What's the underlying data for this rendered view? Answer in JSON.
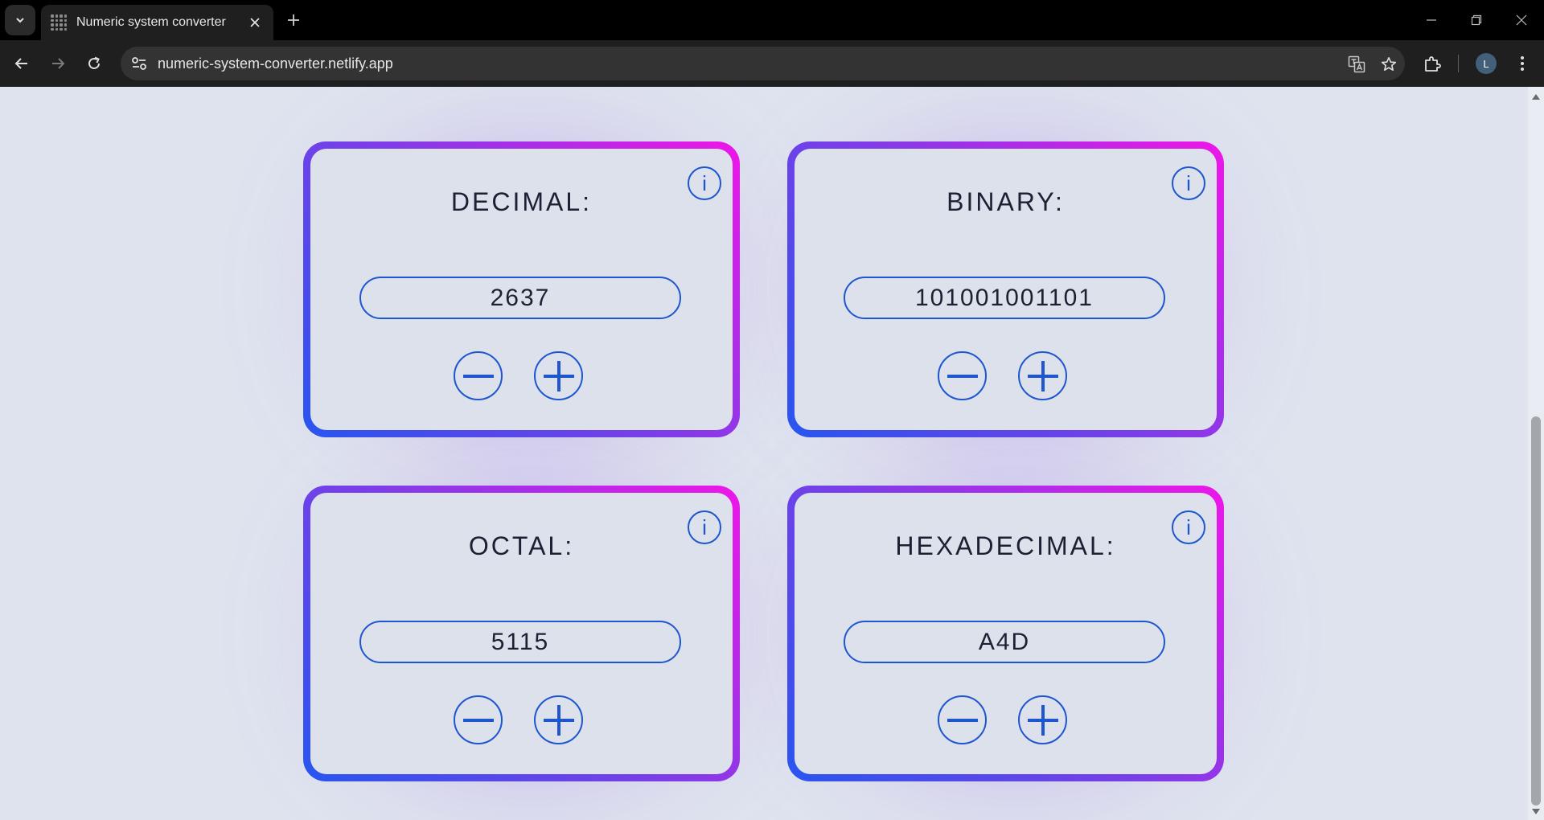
{
  "browser": {
    "tab_title": "Numeric system converter",
    "url": "numeric-system-converter.netlify.app",
    "profile_initial": "L"
  },
  "cards": [
    {
      "title": "DECIMAL:",
      "value": "2637"
    },
    {
      "title": "BINARY:",
      "value": "101001001101"
    },
    {
      "title": "OCTAL:",
      "value": "5115"
    },
    {
      "title": "HEXADECIMAL:",
      "value": "A4D"
    }
  ],
  "info_icon_glyph": "i",
  "colors": {
    "accent": "#1e56cf",
    "gradient_start": "#2855ee",
    "gradient_end": "#ee16e8",
    "background": "#dee3ee"
  }
}
